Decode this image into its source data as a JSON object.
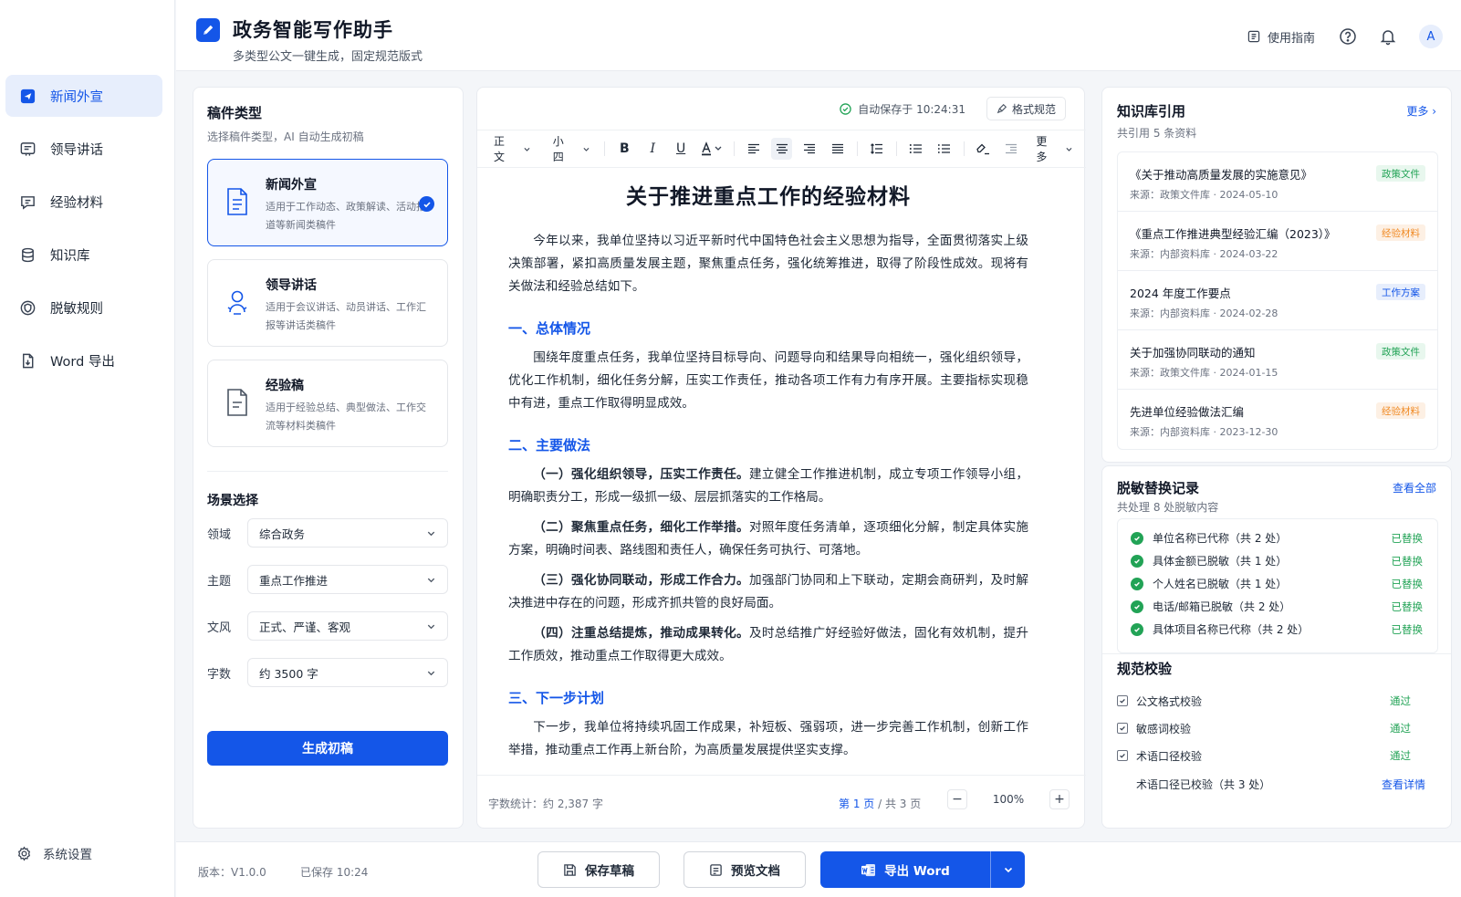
{
  "sidebar": {
    "items": [
      {
        "label": "新闻外宣",
        "icon": "send-icon",
        "active": true
      },
      {
        "label": "领导讲话",
        "icon": "speech-icon"
      },
      {
        "label": "经验材料",
        "icon": "chat-doc-icon"
      },
      {
        "label": "知识库",
        "icon": "database-icon"
      },
      {
        "label": "脱敏规则",
        "icon": "shield-icon"
      },
      {
        "label": "Word 导出",
        "icon": "file-export-icon"
      }
    ],
    "settings_label": "系统设置"
  },
  "header": {
    "title": "政务智能写作助手",
    "subtitle": "多类型公文一键生成，固定规范版式",
    "guide_label": "使用指南",
    "avatar_letter": "A"
  },
  "left": {
    "title": "稿件类型",
    "subtitle": "选择稿件类型，AI 自动生成初稿",
    "types": [
      {
        "title": "新闻外宣",
        "desc": "适用于工作动态、政策解读、活动报道等新闻类稿件",
        "selected": true
      },
      {
        "title": "领导讲话",
        "desc": "适用于会议讲话、动员讲话、工作汇报等讲话类稿件",
        "selected": false
      },
      {
        "title": "经验稿",
        "desc": "适用于经验总结、典型做法、工作交流等材料类稿件",
        "selected": false
      }
    ],
    "scene_title": "场景选择",
    "fields": [
      {
        "label": "领域",
        "value": "综合政务"
      },
      {
        "label": "主题",
        "value": "重点工作推进"
      },
      {
        "label": "文风",
        "value": "正式、严谨、客观"
      },
      {
        "label": "字数",
        "value": "约 3500 字"
      }
    ],
    "generate_label": "生成初稿"
  },
  "editor": {
    "autosave": "自动保存于 10:24:31",
    "format_label": "格式规范",
    "style_value": "正文",
    "size_value": "小四",
    "more_label": "更多",
    "doc_title": "关于推进重点工作的经验材料",
    "intro": "今年以来，我单位坚持以习近平新时代中国特色社会主义思想为指导，全面贯彻落实上级决策部署，紧扣高质量发展主题，聚焦重点任务，强化统筹推进，取得了阶段性成效。现将有关做法和经验总结如下。",
    "h1": "一、总体情况",
    "p1": "围绕年度重点任务，我单位坚持目标导向、问题导向和结果导向相统一，强化组织领导，优化工作机制，细化任务分解，压实工作责任，推动各项工作有力有序开展。主要指标实现稳中有进，重点工作取得明显成效。",
    "h2": "二、主要做法",
    "points": [
      {
        "bold": "（一）强化组织领导，压实工作责任。",
        "text": "建立健全工作推进机制，成立专项工作领导小组，明确职责分工，形成一级抓一级、层层抓落实的工作格局。"
      },
      {
        "bold": "（二）聚焦重点任务，细化工作举措。",
        "text": "对照年度任务清单，逐项细化分解，制定具体实施方案，明确时间表、路线图和责任人，确保任务可执行、可落地。"
      },
      {
        "bold": "（三）强化协同联动，形成工作合力。",
        "text": "加强部门协同和上下联动，定期会商研判，及时解决推进中存在的问题，形成齐抓共管的良好局面。"
      },
      {
        "bold": "（四）注重总结提炼，推动成果转化。",
        "text": "及时总结推广好经验好做法，固化有效机制，提升工作质效，推动重点工作取得更大成效。"
      }
    ],
    "h3": "三、下一步计划",
    "p3": "下一步，我单位将持续巩固工作成果，补短板、强弱项，进一步完善工作机制，创新工作举措，推动重点工作再上新台阶，为高质量发展提供坚实支撑。",
    "word_count": "字数统计：约 2,387 字",
    "page_current": "第 1 页",
    "page_total": " / 共 3 页",
    "zoom": "100%"
  },
  "knowledge": {
    "title": "知识库引用",
    "subtitle": "共引用 5 条资料",
    "more_label": "更多 ›",
    "items": [
      {
        "title": "《关于推动高质量发展的实施意见》",
        "source": "来源：政策文件库 · 2024-05-10",
        "tag": "政策文件",
        "tag_color": "green"
      },
      {
        "title": "《重点工作推进典型经验汇编（2023）》",
        "source": "来源：内部资料库 · 2024-03-22",
        "tag": "经验材料",
        "tag_color": "orange"
      },
      {
        "title": "2024 年度工作要点",
        "source": "来源：内部资料库 · 2024-02-28",
        "tag": "工作方案",
        "tag_color": "blue"
      },
      {
        "title": "关于加强协同联动的通知",
        "source": "来源：政策文件库 · 2024-01-15",
        "tag": "政策文件",
        "tag_color": "green"
      },
      {
        "title": "先进单位经验做法汇编",
        "source": "来源：内部资料库 · 2023-12-30",
        "tag": "经验材料",
        "tag_color": "orange"
      }
    ]
  },
  "desens": {
    "title": "脱敏替换记录",
    "subtitle": "共处理 8 处脱敏内容",
    "view_all_label": "查看全部",
    "rows": [
      {
        "text": "单位名称已代称（共 2 处）",
        "status": "已替换"
      },
      {
        "text": "具体金额已脱敏（共 1 处）",
        "status": "已替换"
      },
      {
        "text": "个人姓名已脱敏（共 1 处）",
        "status": "已替换"
      },
      {
        "text": "电话/邮箱已脱敏（共 2 处）",
        "status": "已替换"
      },
      {
        "text": "具体项目名称已代称（共 2 处）",
        "status": "已替换"
      }
    ]
  },
  "validation": {
    "title": "规范校验",
    "rows": [
      {
        "text": "公文格式校验",
        "status": "通过"
      },
      {
        "text": "敏感词校验",
        "status": "通过"
      },
      {
        "text": "术语口径校验",
        "status": "通过"
      }
    ],
    "note": "术语口径已校验（共 3 处）",
    "detail_label": "查看详情"
  },
  "bottom": {
    "version": "版本：V1.0.0",
    "saved": "已保存 10:24",
    "save_draft_label": "保存草稿",
    "preview_label": "预览文档",
    "export_label": "导出 Word"
  },
  "colors": {
    "primary": "#1456e8",
    "success": "#22a356",
    "warning": "#f08a24"
  }
}
